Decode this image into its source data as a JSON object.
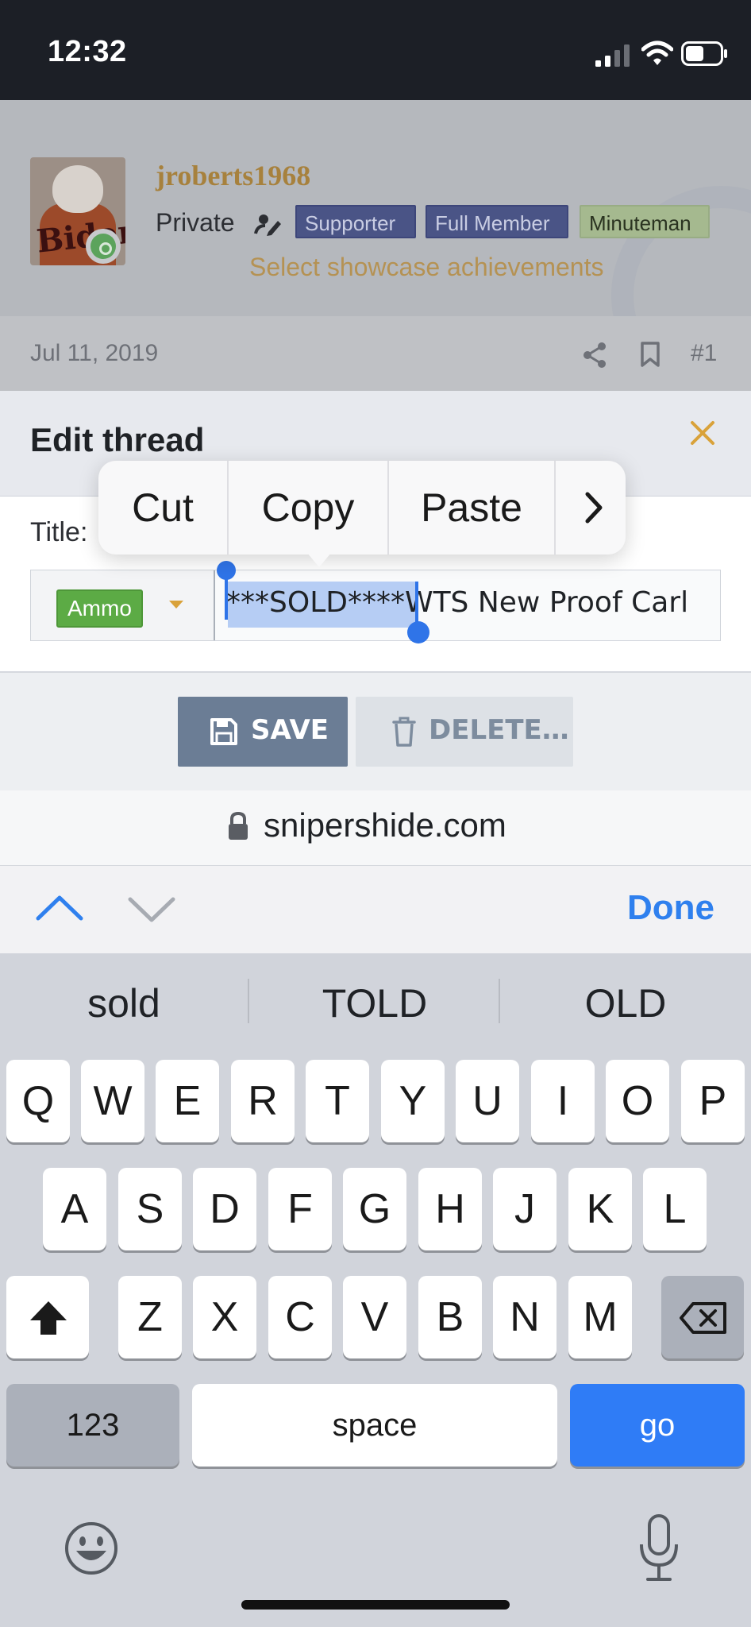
{
  "status_bar": {
    "time": "12:32"
  },
  "post": {
    "username": "jroberts1968",
    "user_title": "Private",
    "banners": [
      "Supporter",
      "Full Member",
      "Minuteman"
    ],
    "showcase_link": "Select showcase achievements",
    "avatar_text": "Biden",
    "date": "Jul 11, 2019",
    "post_number": "#1"
  },
  "modal": {
    "title": "Edit thread",
    "title_label": "Title:",
    "prefix": "Ammo",
    "title_selected": "***SOLD****",
    "title_rest": "WTS New Proof Carl",
    "save_label": "SAVE",
    "delete_label": "DELETE…"
  },
  "edit_menu": {
    "items": [
      "Cut",
      "Copy",
      "Paste"
    ]
  },
  "browser": {
    "domain": "snipershide.com"
  },
  "accessory": {
    "done_label": "Done"
  },
  "keyboard": {
    "suggestions": [
      "sold",
      "TOLD",
      "OLD"
    ],
    "row1": [
      "Q",
      "W",
      "E",
      "R",
      "T",
      "Y",
      "U",
      "I",
      "O",
      "P"
    ],
    "row2": [
      "A",
      "S",
      "D",
      "F",
      "G",
      "H",
      "J",
      "K",
      "L"
    ],
    "row3": [
      "Z",
      "X",
      "C",
      "V",
      "B",
      "N",
      "M"
    ],
    "numbers_label": "123",
    "space_label": "space",
    "go_label": "go"
  },
  "colors": {
    "accent": "#2f80ee",
    "username": "#a7813d",
    "prefix_tag": "#5cab45",
    "selection": "#b6cdf4"
  }
}
